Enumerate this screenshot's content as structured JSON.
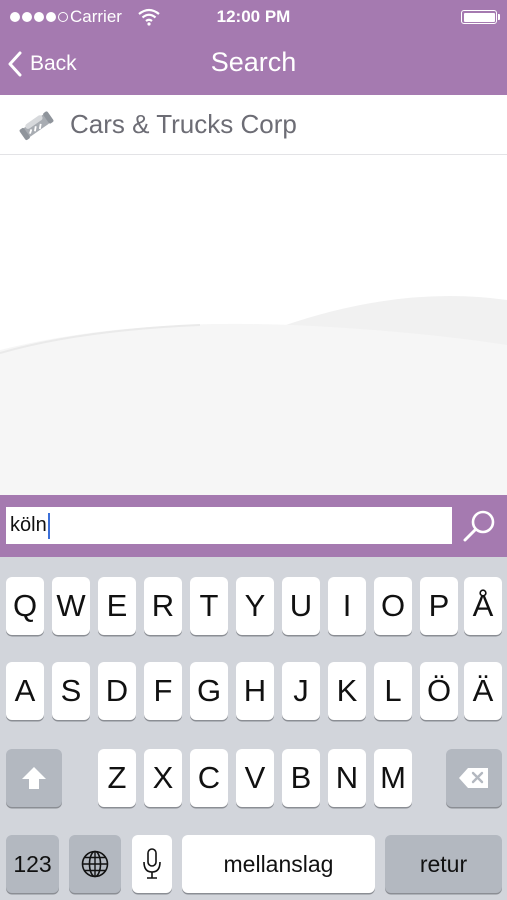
{
  "status_bar": {
    "carrier": "Carrier",
    "time": "12:00 PM"
  },
  "nav": {
    "back_label": "Back",
    "title": "Search"
  },
  "results": [
    {
      "name": "Cars & Trucks Corp",
      "icon": "handshake-icon"
    }
  ],
  "search": {
    "query": "köln",
    "button_icon": "search-icon"
  },
  "keyboard": {
    "row1": [
      "Q",
      "W",
      "E",
      "R",
      "T",
      "Y",
      "U",
      "I",
      "O",
      "P",
      "Å"
    ],
    "row2": [
      "A",
      "S",
      "D",
      "F",
      "G",
      "H",
      "J",
      "K",
      "L",
      "Ö",
      "Ä"
    ],
    "row3": [
      "Z",
      "X",
      "C",
      "V",
      "B",
      "N",
      "M"
    ],
    "numbers_label": "123",
    "space_label": "mellanslag",
    "return_label": "retur"
  },
  "colors": {
    "accent": "#a57ab0",
    "keyboard_bg": "#d2d5db",
    "key_bg": "#ffffff",
    "system_key_bg": "#b3b8c0"
  }
}
